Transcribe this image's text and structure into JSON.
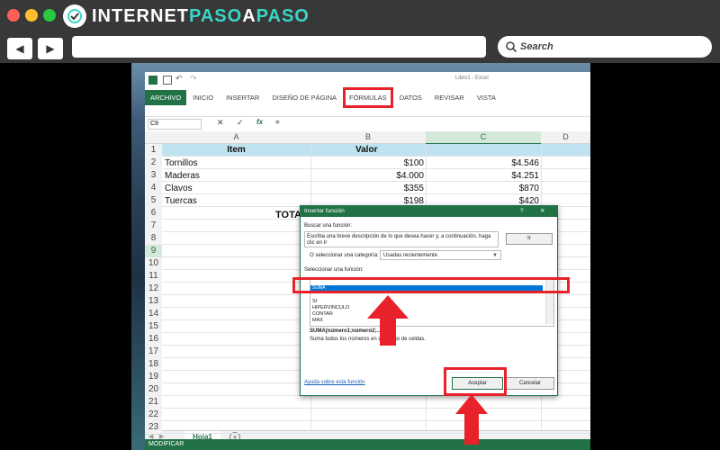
{
  "browser": {
    "brand_part1": "INTERNET",
    "brand_part2": "PASO",
    "brand_part3": "A",
    "brand_part4": "PASO",
    "back_icon": "◀",
    "forward_icon": "▶",
    "search_label": "Search"
  },
  "excel": {
    "window_title": "Libro1 - Excel",
    "ribbon_tabs": [
      "ARCHIVO",
      "INICIO",
      "INSERTAR",
      "DISEÑO DE PÁGINA",
      "FÓRMULAS",
      "DATOS",
      "REVISAR",
      "VISTA"
    ],
    "name_box": "C9",
    "formula_value": "=",
    "fx_label": "fx",
    "columns": [
      "A",
      "B",
      "C",
      "D"
    ],
    "rows": [
      "1",
      "2",
      "3",
      "4",
      "5",
      "6",
      "7",
      "8",
      "9",
      "10",
      "11",
      "12",
      "13",
      "14",
      "15",
      "16",
      "17",
      "18",
      "19",
      "20",
      "21",
      "22",
      "23"
    ],
    "header_item": "Item",
    "header_valor": "Valor",
    "items": [
      {
        "name": "Tornillos",
        "b": "$100",
        "c": "$4.546"
      },
      {
        "name": "Maderas",
        "b": "$4.000",
        "c": "$4.251"
      },
      {
        "name": "Clavos",
        "b": "$355",
        "c": "$870"
      },
      {
        "name": "Tuercas",
        "b": "$198",
        "c": "$420"
      }
    ],
    "total_label": "TOTAL",
    "sheet_tab": "Hoja1",
    "status": "MODIFICAR"
  },
  "dialog": {
    "title": "Insertar función",
    "help": "?",
    "close": "✕",
    "search_label": "Buscar una función:",
    "search_text": "Escriba una breve descripción de lo que desea hacer y, a continuación, haga clic en Ir",
    "go_button": "Ir",
    "category_label": "O seleccionar una categoría:",
    "category_value": "Usadas recientemente",
    "select_label": "Seleccionar una función:",
    "functions": [
      "SUMA",
      "SI",
      "HIPERVINCULO",
      "CONTAR",
      "MAX"
    ],
    "selected_function": "SUMA",
    "signature": "SUMA(número1;número2;...)",
    "description": "Suma todos los números en un rango de celdas.",
    "help_link": "Ayuda sobre esta función",
    "accept": "Aceptar",
    "cancel": "Cancelar"
  },
  "colors": {
    "excel_green": "#217346",
    "highlight_red": "#e8222a",
    "selection_blue": "#0078d7",
    "brand_teal": "#3bd5c7"
  }
}
